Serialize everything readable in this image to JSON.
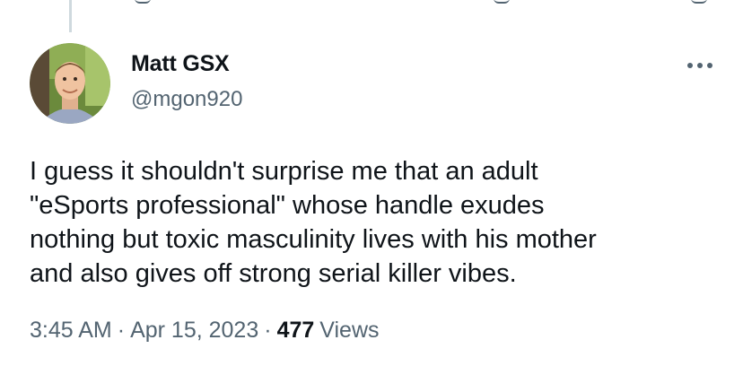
{
  "tweet": {
    "author_name": "Matt GSX",
    "author_handle": "@mgon920",
    "text": "I guess it shouldn't surprise me that an adult\n\"eSports professional\" whose handle exudes\nnothing but toxic masculinity lives with his mother\nand also gives off strong serial killer vibes.",
    "time": "3:45 AM",
    "separator": "·",
    "date": "Apr 15, 2023",
    "views_count": "477",
    "views_label": "Views"
  },
  "icons": {
    "more": "more-options-icon",
    "avatar": "profile-photo"
  },
  "colors": {
    "text_primary": "#0f1419",
    "text_secondary": "#536471",
    "thread_line": "#cfd9de"
  }
}
